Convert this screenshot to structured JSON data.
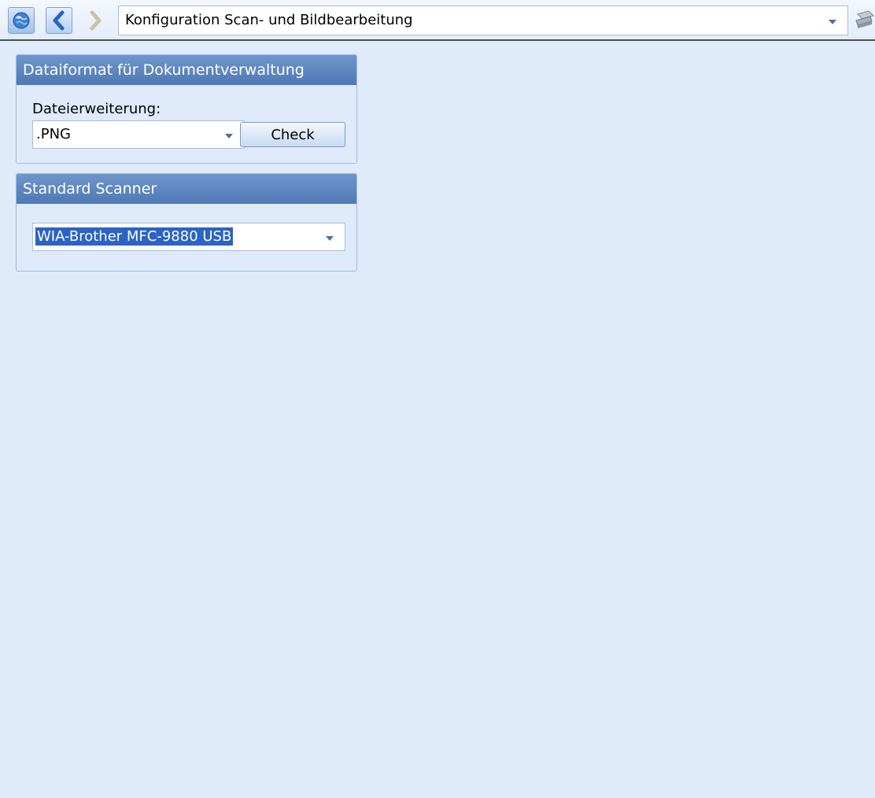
{
  "toolbar": {
    "icons": {
      "home": "globe-home-icon",
      "back": "chevron-left-icon",
      "forward": "chevron-right-icon",
      "tool": "scanner-tool-icon"
    },
    "navigation_title": "Konfiguration Scan- und Bildbearbeitung"
  },
  "panels": {
    "format": {
      "title": "Dataiformat für Dokumentverwaltung",
      "extension_label": "Dateierweiterung:",
      "extension_value": ".PNG",
      "check_label": "Check"
    },
    "scanner": {
      "title": "Standard Scanner",
      "selected_scanner": "WIA-Brother MFC-9880 USB"
    }
  },
  "colors": {
    "background": "#dfeafa",
    "panel_header": "#5a84bf",
    "selection": "#2b63c6"
  }
}
